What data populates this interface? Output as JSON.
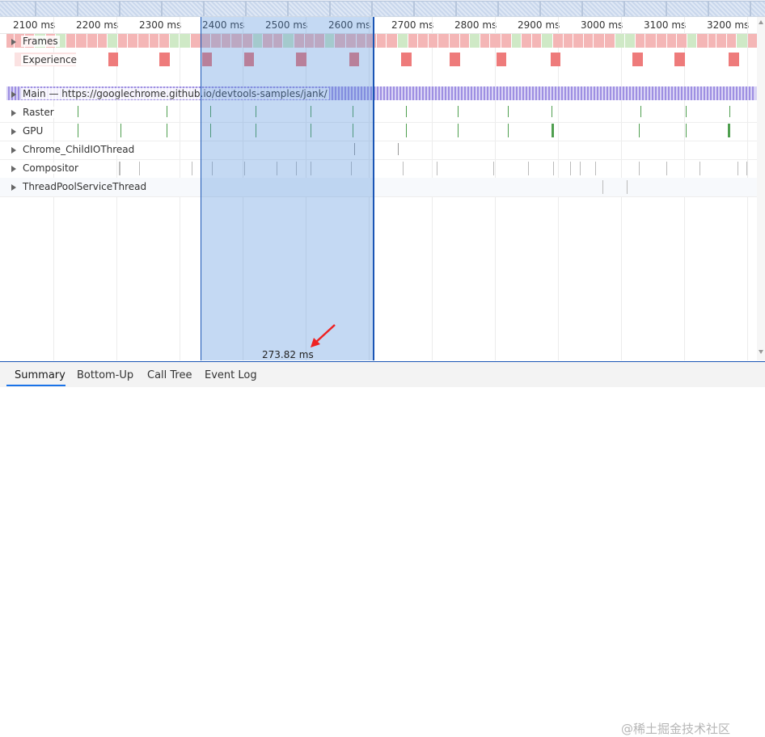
{
  "ruler": {
    "ticks": [
      "2100 ms",
      "2200 ms",
      "2300 ms",
      "2400 ms",
      "2500 ms",
      "2600 ms",
      "2700 ms",
      "2800 ms",
      "2900 ms",
      "3000 ms",
      "3100 ms",
      "3200 ms"
    ]
  },
  "tracks": {
    "frames": "Frames",
    "experience": "Experience",
    "main": "Main — https://googlechrome.github.io/devtools-samples/jank/",
    "raster": "Raster",
    "gpu": "GPU",
    "chrome_child_io": "Chrome_ChildIOThread",
    "compositor": "Compositor",
    "thread_pool": "ThreadPoolServiceThread"
  },
  "selection": {
    "duration": "273.82 ms"
  },
  "tabs": {
    "summary": "Summary",
    "bottom_up": "Bottom-Up",
    "call_tree": "Call Tree",
    "event_log": "Event Log"
  },
  "colors": {
    "frame_red": "#f4b6b6",
    "frame_green": "#cfe9c6",
    "experience_red": "#ee7b7b",
    "main_purple": "#9e8fe2",
    "gpu_green": "#4f9f4f",
    "selection_blue": "#1a55b5"
  },
  "watermark": "@稀土掘金技术社区"
}
